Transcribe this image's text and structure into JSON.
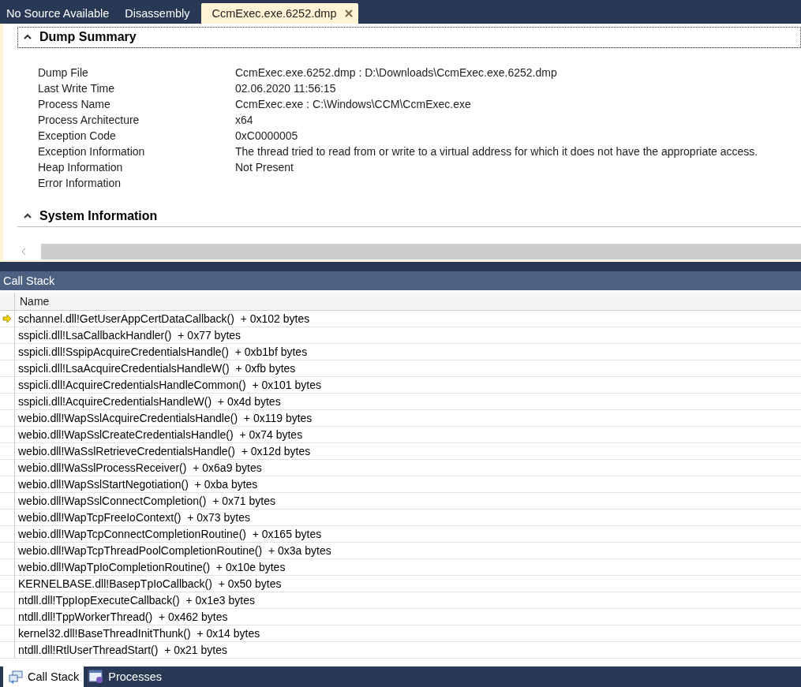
{
  "doc_tabs": [
    {
      "label": "No Source Available",
      "selected": false,
      "closable": false
    },
    {
      "label": "Disassembly",
      "selected": false,
      "closable": false
    },
    {
      "label": "CcmExec.exe.6252.dmp",
      "selected": true,
      "closable": true
    }
  ],
  "sections": [
    {
      "title": "Dump Summary",
      "expanded": true,
      "fields": [
        {
          "label": "Dump File",
          "value": "CcmExec.exe.6252.dmp : D:\\Downloads\\CcmExec.exe.6252.dmp"
        },
        {
          "label": "Last Write Time",
          "value": "02.06.2020 11:56:15"
        },
        {
          "label": "Process Name",
          "value": "CcmExec.exe : C:\\Windows\\CCM\\CcmExec.exe"
        },
        {
          "label": "Process Architecture",
          "value": "x64"
        },
        {
          "label": "Exception Code",
          "value": "0xC0000005"
        },
        {
          "label": "Exception Information",
          "value": "The thread tried to read from or write to a virtual address for which it does not have the appropriate access."
        },
        {
          "label": "Heap Information",
          "value": "Not Present"
        },
        {
          "label": "Error Information"
        }
      ]
    },
    {
      "title": "System Information",
      "expanded": true
    }
  ],
  "call_stack": {
    "title": "Call Stack",
    "columns": [
      "Name"
    ],
    "rows": [
      {
        "name": "schannel.dll!GetUserAppCertDataCallback()  + 0x102 bytes",
        "current": true
      },
      {
        "name": "sspicli.dll!LsaCallbackHandler()  + 0x77 bytes",
        "current": false
      },
      {
        "name": "sspicli.dll!SspipAcquireCredentialsHandle()  + 0xb1bf bytes",
        "current": false
      },
      {
        "name": "sspicli.dll!LsaAcquireCredentialsHandleW()  + 0xfb bytes",
        "current": false
      },
      {
        "name": "sspicli.dll!AcquireCredentialsHandleCommon()  + 0x101 bytes",
        "current": false
      },
      {
        "name": "sspicli.dll!AcquireCredentialsHandleW()  + 0x4d bytes",
        "current": false
      },
      {
        "name": "webio.dll!WapSslAcquireCredentialsHandle()  + 0x119 bytes",
        "current": false
      },
      {
        "name": "webio.dll!WapSslCreateCredentialsHandle()  + 0x74 bytes",
        "current": false
      },
      {
        "name": "webio.dll!WaSslRetrieveCredentialsHandle()  + 0x12d bytes",
        "current": false
      },
      {
        "name": "webio.dll!WaSslProcessReceiver()  + 0x6a9 bytes",
        "current": false
      },
      {
        "name": "webio.dll!WapSslStartNegotiation()  + 0xba bytes",
        "current": false
      },
      {
        "name": "webio.dll!WapSslConnectCompletion()  + 0x71 bytes",
        "current": false
      },
      {
        "name": "webio.dll!WapTcpFreeIoContext()  + 0x73 bytes",
        "current": false
      },
      {
        "name": "webio.dll!WapTcpConnectCompletionRoutine()  + 0x165 bytes",
        "current": false
      },
      {
        "name": "webio.dll!WapTcpThreadPoolCompletionRoutine()  + 0x3a bytes",
        "current": false
      },
      {
        "name": "webio.dll!WapTpIoCompletionRoutine()  + 0x10e bytes",
        "current": false
      },
      {
        "name": "KERNELBASE.dll!BasepTpIoCallback()  + 0x50 bytes",
        "current": false
      },
      {
        "name": "ntdll.dll!TppIopExecuteCallback()  + 0x1e3 bytes",
        "current": false
      },
      {
        "name": "ntdll.dll!TppWorkerThread()  + 0x462 bytes",
        "current": false
      },
      {
        "name": "kernel32.dll!BaseThreadInitThunk()  + 0x14 bytes",
        "current": false
      },
      {
        "name": "ntdll.dll!RtlUserThreadStart()  + 0x21 bytes",
        "current": false
      }
    ]
  },
  "tool_tabs": [
    {
      "label": "Call Stack",
      "selected": true,
      "kind": "callstack"
    },
    {
      "label": "Processes",
      "selected": false,
      "kind": "processes"
    }
  ]
}
